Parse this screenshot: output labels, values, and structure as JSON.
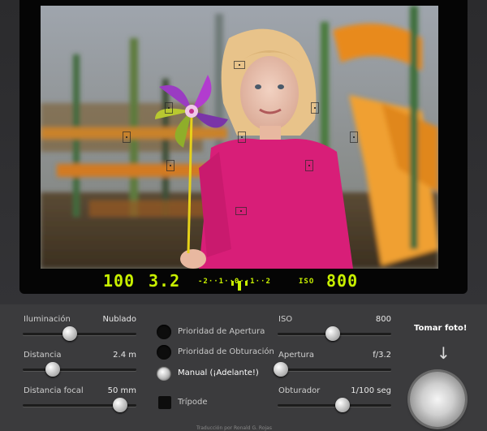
{
  "readouts": {
    "iso_value": "100",
    "aperture_value": "3.2",
    "meter_scale": "-2··1··0··1··2",
    "iso_label": "ISO",
    "iso_setting": "800"
  },
  "left_sliders": [
    {
      "label": "Iluminación",
      "value": "Nublado",
      "level": 0.45
    },
    {
      "label": "Distancia",
      "value": "2.4 m",
      "level": 0.27
    },
    {
      "label": "Distancia focal",
      "value": "50 mm",
      "level": 0.85
    }
  ],
  "modes": [
    {
      "label": "Prioridad de Apertura",
      "selected": false
    },
    {
      "label": "Prioridad de Obturación",
      "selected": false
    },
    {
      "label": "Manual (¡Adelante!)",
      "selected": true
    }
  ],
  "tripod": {
    "label": "Trípode",
    "checked": false
  },
  "right_sliders": [
    {
      "label": "ISO",
      "value": "800",
      "level": 0.48
    },
    {
      "label": "Apertura",
      "value": "f/3.2",
      "level": 0.03
    },
    {
      "label": "Obturador",
      "value": "1/100 seg",
      "level": 0.57
    }
  ],
  "shutter": {
    "label": "Tomar foto!",
    "arrow": "↓"
  },
  "footer": {
    "credit": "Traducción por Ronald G. Rojas"
  },
  "colors": {
    "lcd": "#c8f000",
    "bezel": "#3b3b3d"
  }
}
